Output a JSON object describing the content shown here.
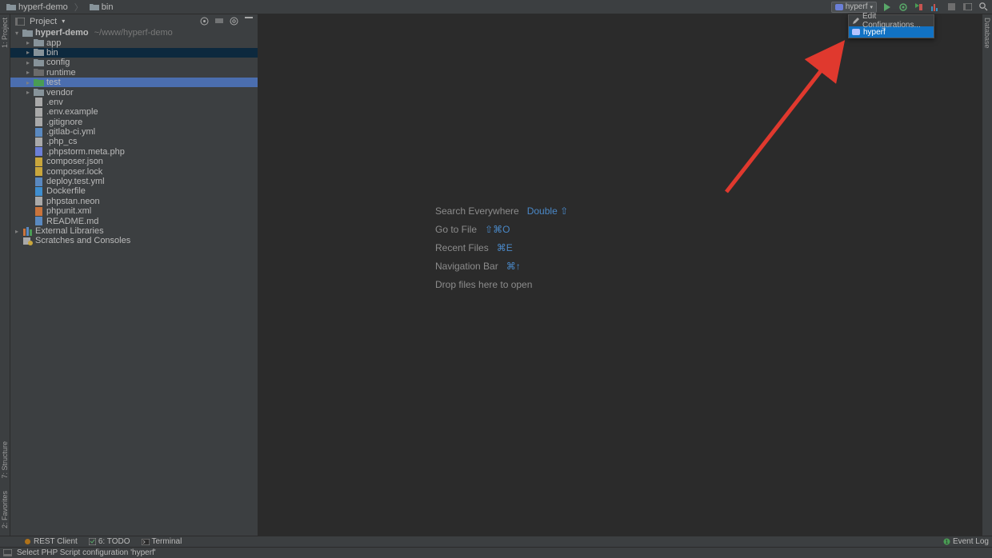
{
  "breadcrumb": [
    {
      "icon": "folder",
      "label": "hyperf-demo"
    },
    {
      "icon": "folder",
      "label": "bin"
    }
  ],
  "toolbar": {
    "run_config_selected": "hyperf",
    "icons": [
      "run",
      "debug",
      "coverage",
      "profile",
      "stop",
      "open",
      "search"
    ]
  },
  "runcfg_popup": {
    "items": [
      {
        "icon": "pencil",
        "label": "Edit Configurations...",
        "selected": false
      },
      {
        "icon": "php",
        "label": "hyperf",
        "selected": true
      }
    ]
  },
  "project_header": {
    "title": "Project"
  },
  "tree": [
    {
      "depth": 0,
      "arrow": "down",
      "icon": "folder",
      "label": "hyperf-demo",
      "path": "~/www/hyperf-demo",
      "bold": true
    },
    {
      "depth": 1,
      "arrow": "right",
      "icon": "folder",
      "label": "app"
    },
    {
      "depth": 1,
      "arrow": "right",
      "icon": "folder",
      "label": "bin",
      "sel": "sel1"
    },
    {
      "depth": 1,
      "arrow": "right",
      "icon": "folder",
      "label": "config"
    },
    {
      "depth": 1,
      "arrow": "right",
      "icon": "folder-dark",
      "label": "runtime"
    },
    {
      "depth": 1,
      "arrow": "right",
      "icon": "folder-test",
      "label": "test",
      "sel": "sel2"
    },
    {
      "depth": 1,
      "arrow": "right",
      "icon": "folder",
      "label": "vendor"
    },
    {
      "depth": 1,
      "arrow": "",
      "icon": "file",
      "label": ".env"
    },
    {
      "depth": 1,
      "arrow": "",
      "icon": "file",
      "label": ".env.example"
    },
    {
      "depth": 1,
      "arrow": "",
      "icon": "file",
      "label": ".gitignore"
    },
    {
      "depth": 1,
      "arrow": "",
      "icon": "yml",
      "label": ".gitlab-ci.yml"
    },
    {
      "depth": 1,
      "arrow": "",
      "icon": "file",
      "label": ".php_cs"
    },
    {
      "depth": 1,
      "arrow": "",
      "icon": "php-meta",
      "label": ".phpstorm.meta.php"
    },
    {
      "depth": 1,
      "arrow": "",
      "icon": "json",
      "label": "composer.json"
    },
    {
      "depth": 1,
      "arrow": "",
      "icon": "json",
      "label": "composer.lock"
    },
    {
      "depth": 1,
      "arrow": "",
      "icon": "yml",
      "label": "deploy.test.yml"
    },
    {
      "depth": 1,
      "arrow": "",
      "icon": "docker",
      "label": "Dockerfile"
    },
    {
      "depth": 1,
      "arrow": "",
      "icon": "neon",
      "label": "phpstan.neon"
    },
    {
      "depth": 1,
      "arrow": "",
      "icon": "xml",
      "label": "phpunit.xml"
    },
    {
      "depth": 1,
      "arrow": "",
      "icon": "md",
      "label": "README.md"
    },
    {
      "depth": 0,
      "arrow": "right",
      "icon": "lib",
      "label": "External Libraries"
    },
    {
      "depth": 0,
      "arrow": "",
      "icon": "scratch",
      "label": "Scratches and Consoles"
    }
  ],
  "welcome": [
    {
      "label": "Search Everywhere",
      "shortcut": "Double ⇧"
    },
    {
      "label": "Go to File",
      "shortcut": "⇧⌘O"
    },
    {
      "label": "Recent Files",
      "shortcut": "⌘E"
    },
    {
      "label": "Navigation Bar",
      "shortcut": "⌘↑"
    },
    {
      "label": "Drop files here to open",
      "shortcut": ""
    }
  ],
  "left_gutter": [
    {
      "label": "1: Project",
      "pos": 0
    },
    {
      "label": "7: Structure",
      "pos": 530
    },
    {
      "label": "2: Favorites",
      "pos": 590
    }
  ],
  "right_gutter": [
    {
      "label": "Database",
      "pos": 0
    }
  ],
  "bottom_tools": [
    {
      "icon": "rest",
      "label": "REST Client"
    },
    {
      "icon": "todo",
      "label": "6: TODO"
    },
    {
      "icon": "terminal",
      "label": "Terminal"
    }
  ],
  "event_log_label": "Event Log",
  "status_text": "Select PHP Script configuration 'hyperf'"
}
